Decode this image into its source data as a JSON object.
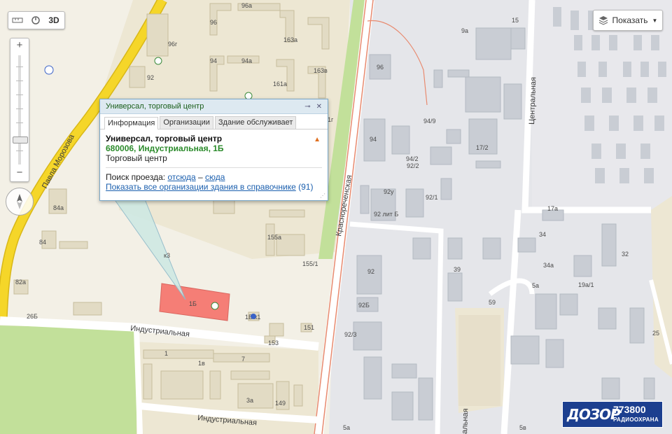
{
  "map": {
    "streets": {
      "pavla_morozova": "Павла Морозова",
      "krasnorechenskaya": "Краснореченская",
      "tsentralnaya": "Центральная",
      "industrialnaya_1": "Индустриальная",
      "industrialnaya_2": "Индустриальная",
      "bottom_partial": "альная"
    },
    "building_labels": [
      "96а",
      "96",
      "96г",
      "163а",
      "94",
      "94а",
      "92",
      "163в",
      "161а",
      "1г",
      "84а",
      "84",
      "82а",
      "26Б",
      "155а",
      "155/1",
      "1Б",
      "1Б к1",
      "151",
      "153",
      "1",
      "1в",
      "7",
      "3а",
      "149",
      "5а",
      "96",
      "94",
      "92у",
      "92 лит Б",
      "92/1",
      "92/2",
      "94/9",
      "94/2",
      "17/2",
      "92",
      "92Б",
      "92/3",
      "39",
      "59",
      "5а",
      "19а/1",
      "34а",
      "34",
      "17а",
      "32",
      "25",
      "9а",
      "15",
      "5в",
      "к3"
    ],
    "target_label": "1Б"
  },
  "controls": {
    "ruler_icon": "ruler-icon",
    "magnifier_icon": "magnifier-icon",
    "three_d_label": "3D",
    "zoom_in": "+",
    "zoom_out": "−",
    "layers_label": "Показать"
  },
  "balloon": {
    "header_title": "Универсал, торговый центр",
    "tabs": [
      "Информация",
      "Организации",
      "Здание обслуживает"
    ],
    "active_tab": "Информация",
    "name": "Универсал, торговый центр",
    "address": "680006, Индустриальная, 1Б",
    "category": "Торговый центр",
    "route_prefix": "Поиск проезда:",
    "route_from": "отсюда",
    "route_dash": "–",
    "route_to": "сюда",
    "all_orgs": "Показать все организации здания в справочнике",
    "all_orgs_count": "(91)"
  },
  "logo": {
    "brand": "ДОЗОР",
    "phone": "773800",
    "subtitle": "РАДИООХРАНА"
  },
  "colors": {
    "building": "#e2dbc4",
    "building_stroke": "#c6bc9d",
    "industrial": "#c9cdd4",
    "industrial_bg": "#e5e6ea",
    "road_yellow": "#f5d629",
    "green": "#c2e09a",
    "target": "#f57e76",
    "road_red": "#e88a6f"
  }
}
